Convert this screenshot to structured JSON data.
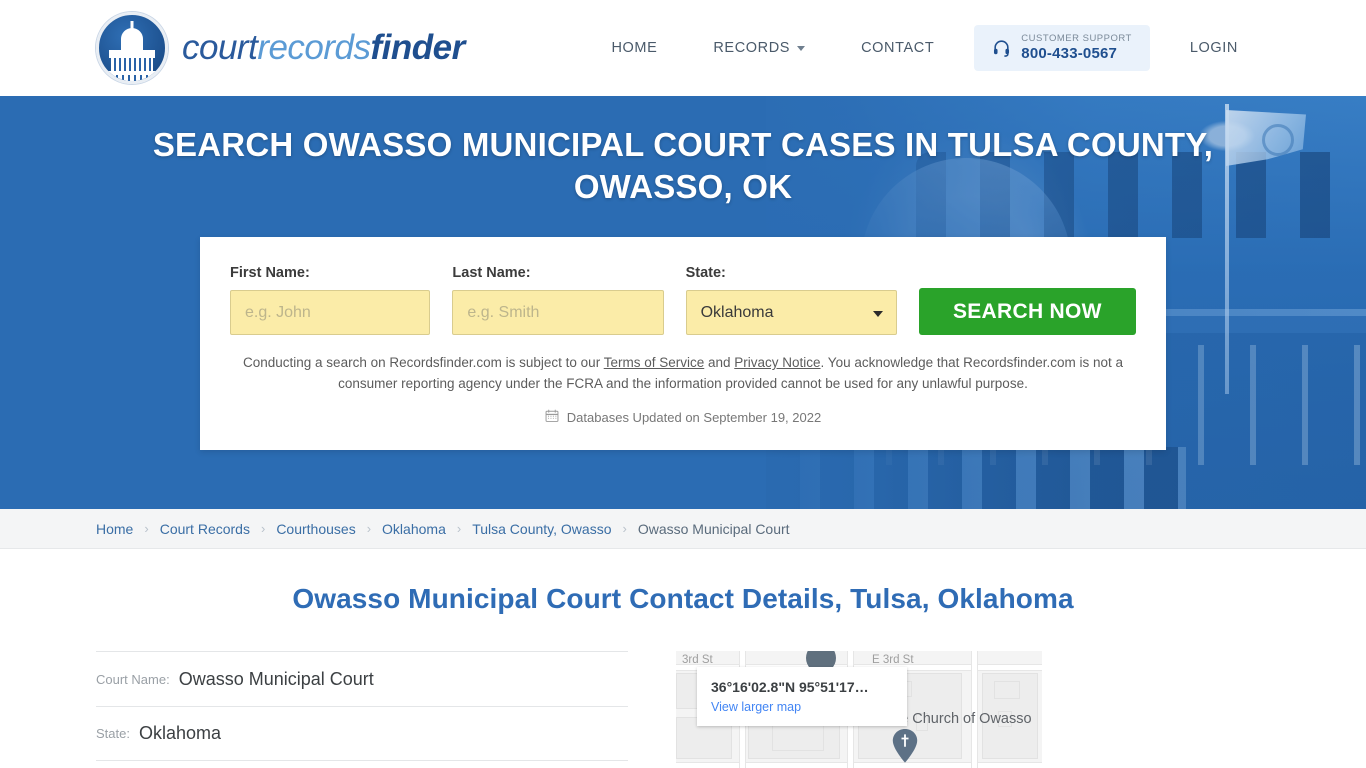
{
  "brand": {
    "word1": "court",
    "word2": "records",
    "word3": "finder",
    "logo_icon": "capitol-dome-icon"
  },
  "nav": {
    "home": "HOME",
    "records": "RECORDS",
    "contact": "CONTACT",
    "login": "LOGIN",
    "support_label": "CUSTOMER SUPPORT",
    "support_phone": "800-433-0567",
    "support_icon": "headset-icon",
    "records_caret": "chevron-down-icon"
  },
  "hero": {
    "title": "SEARCH OWASSO MUNICIPAL COURT CASES IN TULSA COUNTY, OWASSO, OK"
  },
  "search": {
    "first_name_label": "First Name:",
    "first_name_value": "",
    "first_name_placeholder": "e.g. John",
    "last_name_label": "Last Name:",
    "last_name_value": "",
    "last_name_placeholder": "e.g. Smith",
    "state_label": "State:",
    "state_value": "Oklahoma",
    "submit_label": "SEARCH NOW",
    "disclaimer_part1": "Conducting a search on Recordsfinder.com is subject to our ",
    "terms_link": "Terms of Service",
    "disclaimer_and": " and ",
    "privacy_link": "Privacy Notice",
    "disclaimer_part2": ". You acknowledge that Recordsfinder.com is not a consumer reporting agency under the FCRA and the information provided cannot be used for any unlawful purpose.",
    "updated_text": "Databases Updated on September 19, 2022",
    "updated_icon": "calendar-icon"
  },
  "breadcrumb": {
    "separator": "›",
    "items": [
      {
        "label": "Home",
        "current": false
      },
      {
        "label": "Court Records",
        "current": false
      },
      {
        "label": "Courthouses",
        "current": false
      },
      {
        "label": "Oklahoma",
        "current": false
      },
      {
        "label": "Tulsa County, Owasso",
        "current": false
      },
      {
        "label": "Owasso Municipal Court",
        "current": true
      }
    ]
  },
  "page": {
    "heading": "Owasso Municipal Court Contact Details, Tulsa, Oklahoma"
  },
  "details": [
    {
      "key": "Court Name:",
      "value": "Owasso Municipal Court"
    },
    {
      "key": "State:",
      "value": "Oklahoma"
    }
  ],
  "map": {
    "coordinates": "36°16'02.8\"N 95°51'17…",
    "view_larger": "View larger map",
    "label_left": "3rd St",
    "label_right": "E 3rd St",
    "poi": "Bible Church of Owasso",
    "pin_icon": "church-map-pin-icon"
  },
  "colors": {
    "hero_blue": "#2b6cb3",
    "brand_blue": "#1f4f8f",
    "accent_light_blue": "#5b9bd5",
    "button_green": "#2aa32a",
    "input_yellow": "#fbeca8",
    "heading_blue": "#2f6cb5",
    "link_blue": "#4285f4",
    "breadcrumb_bg": "#f4f5f6"
  }
}
